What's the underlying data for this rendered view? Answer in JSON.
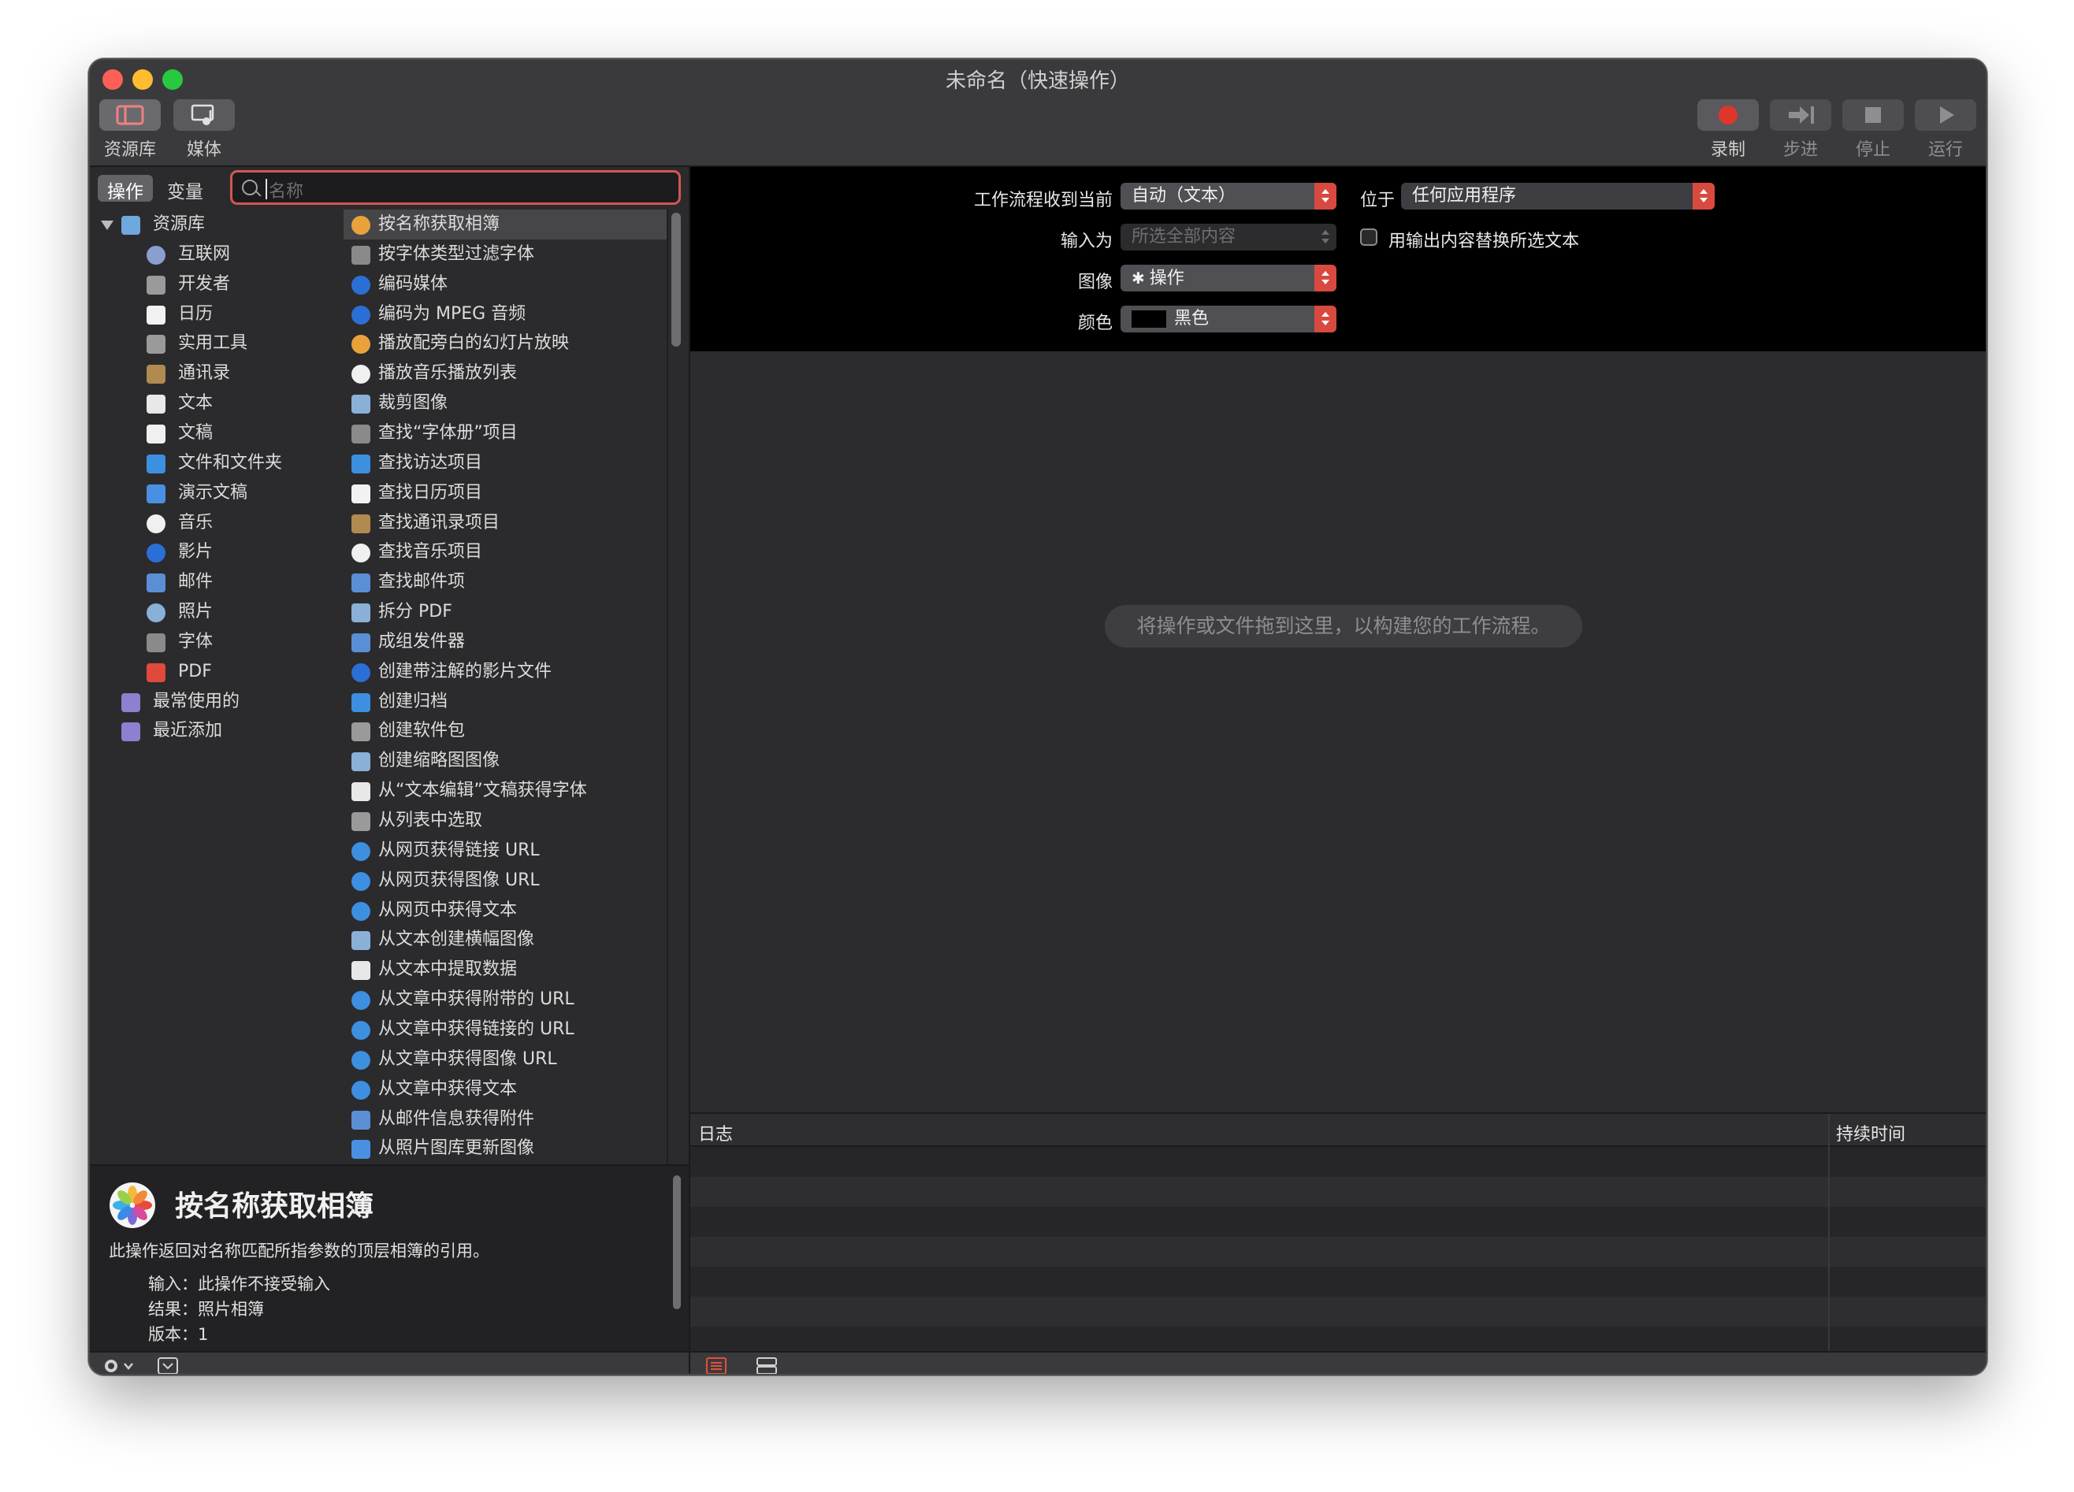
{
  "window": {
    "title": "未命名（快速操作）"
  },
  "toolbar": {
    "library_label": "资源库",
    "media_label": "媒体",
    "record_label": "录制",
    "step_label": "步进",
    "stop_label": "停止",
    "run_label": "运行"
  },
  "library": {
    "tab_actions": "操作",
    "tab_variables": "变量",
    "search_placeholder": "名称",
    "categories": [
      {
        "label": "资源库",
        "icon": "library-icon",
        "color": "#6fa8dc"
      },
      {
        "label": "互联网",
        "icon": "globe-icon",
        "color": "#8a9fd0"
      },
      {
        "label": "开发者",
        "icon": "tools-icon",
        "color": "#9a9a9a"
      },
      {
        "label": "日历",
        "icon": "calendar-icon",
        "color": "#f2f2f2"
      },
      {
        "label": "实用工具",
        "icon": "tools-icon",
        "color": "#9a9a9a"
      },
      {
        "label": "通讯录",
        "icon": "contacts-icon",
        "color": "#b08a4e"
      },
      {
        "label": "文本",
        "icon": "text-icon",
        "color": "#e8e8e8"
      },
      {
        "label": "文稿",
        "icon": "document-icon",
        "color": "#f0f0f0"
      },
      {
        "label": "文件和文件夹",
        "icon": "finder-icon",
        "color": "#3d8fe0"
      },
      {
        "label": "演示文稿",
        "icon": "presentation-icon",
        "color": "#4a90e2"
      },
      {
        "label": "音乐",
        "icon": "music-icon",
        "color": "#f0f0f0"
      },
      {
        "label": "影片",
        "icon": "movie-icon",
        "color": "#2a6fd6"
      },
      {
        "label": "邮件",
        "icon": "mail-icon",
        "color": "#5a8fd6"
      },
      {
        "label": "照片",
        "icon": "photos-icon",
        "color": "#8ab0d8"
      },
      {
        "label": "字体",
        "icon": "font-book-icon",
        "color": "#8a8a8a"
      },
      {
        "label": "PDF",
        "icon": "pdf-icon",
        "color": "#e04a3a"
      },
      {
        "label": "最常使用的",
        "icon": "smart-folder-icon",
        "color": "#8e7fd0"
      },
      {
        "label": "最近添加",
        "icon": "smart-folder-icon",
        "color": "#8e7fd0"
      }
    ],
    "actions": [
      {
        "label": "按名称获取相簿",
        "icon": "photos-icon",
        "color": "#e9a23b"
      },
      {
        "label": "按字体类型过滤字体",
        "icon": "font-book-icon",
        "color": "#8a8a8a"
      },
      {
        "label": "编码媒体",
        "icon": "movie-icon",
        "color": "#2a6fd6"
      },
      {
        "label": "编码为 MPEG 音频",
        "icon": "movie-icon",
        "color": "#2a6fd6"
      },
      {
        "label": "播放配旁白的幻灯片放映",
        "icon": "photos-icon",
        "color": "#e9a23b"
      },
      {
        "label": "播放音乐播放列表",
        "icon": "music-icon",
        "color": "#f0f0f0"
      },
      {
        "label": "裁剪图像",
        "icon": "preview-icon",
        "color": "#8ab0d8"
      },
      {
        "label": "查找“字体册”项目",
        "icon": "font-book-icon",
        "color": "#8a8a8a"
      },
      {
        "label": "查找访达项目",
        "icon": "finder-icon",
        "color": "#3d8fe0"
      },
      {
        "label": "查找日历项目",
        "icon": "calendar-icon",
        "color": "#f2f2f2"
      },
      {
        "label": "查找通讯录项目",
        "icon": "contacts-icon",
        "color": "#b08a4e"
      },
      {
        "label": "查找音乐项目",
        "icon": "music-icon",
        "color": "#f0f0f0"
      },
      {
        "label": "查找邮件项",
        "icon": "mail-icon",
        "color": "#5a8fd6"
      },
      {
        "label": "拆分 PDF",
        "icon": "preview-icon",
        "color": "#8ab0d8"
      },
      {
        "label": "成组发件器",
        "icon": "mail-icon",
        "color": "#5a8fd6"
      },
      {
        "label": "创建带注解的影片文件",
        "icon": "movie-icon",
        "color": "#2a6fd6"
      },
      {
        "label": "创建归档",
        "icon": "finder-icon",
        "color": "#3d8fe0"
      },
      {
        "label": "创建软件包",
        "icon": "tools-icon",
        "color": "#9a9a9a"
      },
      {
        "label": "创建缩略图图像",
        "icon": "preview-icon",
        "color": "#8ab0d8"
      },
      {
        "label": "从“文本编辑”文稿获得字体",
        "icon": "text-icon",
        "color": "#e8e8e8"
      },
      {
        "label": "从列表中选取",
        "icon": "automator-icon",
        "color": "#9a9a9a"
      },
      {
        "label": "从网页获得链接 URL",
        "icon": "safari-icon",
        "color": "#3d8fe0"
      },
      {
        "label": "从网页获得图像 URL",
        "icon": "safari-icon",
        "color": "#3d8fe0"
      },
      {
        "label": "从网页中获得文本",
        "icon": "safari-icon",
        "color": "#3d8fe0"
      },
      {
        "label": "从文本创建横幅图像",
        "icon": "preview-icon",
        "color": "#8ab0d8"
      },
      {
        "label": "从文本中提取数据",
        "icon": "text-icon",
        "color": "#e8e8e8"
      },
      {
        "label": "从文章中获得附带的 URL",
        "icon": "safari-icon",
        "color": "#3d8fe0"
      },
      {
        "label": "从文章中获得链接的 URL",
        "icon": "safari-icon",
        "color": "#3d8fe0"
      },
      {
        "label": "从文章中获得图像 URL",
        "icon": "safari-icon",
        "color": "#3d8fe0"
      },
      {
        "label": "从文章中获得文本",
        "icon": "safari-icon",
        "color": "#3d8fe0"
      },
      {
        "label": "从邮件信息获得附件",
        "icon": "mail-icon",
        "color": "#5a8fd6"
      },
      {
        "label": "从照片图库更新图像",
        "icon": "presentation-icon",
        "color": "#4a90e2"
      }
    ]
  },
  "description": {
    "title": "按名称获取相簿",
    "text": "此操作返回对名称匹配所指参数的顶层相簿的引用。",
    "input_key": "输入：",
    "input_value": "此操作不接受输入",
    "result_key": "结果：",
    "result_value": "照片相簿",
    "version_key": "版本：",
    "version_value": "1"
  },
  "config": {
    "receives_label": "工作流程收到当前",
    "receives_value": "自动（文本）",
    "in_label": "位于",
    "in_value": "任何应用程序",
    "input_is_label": "输入为",
    "input_is_value": "所选全部内容",
    "replace_label": "用输出内容替换所选文本",
    "image_label": "图像",
    "image_value": "操作",
    "color_label": "颜色",
    "color_value": "黑色",
    "accent": "#d8493f"
  },
  "canvas": {
    "hint": "将操作或文件拖到这里，以构建您的工作流程。"
  },
  "log": {
    "col_log": "日志",
    "col_duration": "持续时间"
  }
}
